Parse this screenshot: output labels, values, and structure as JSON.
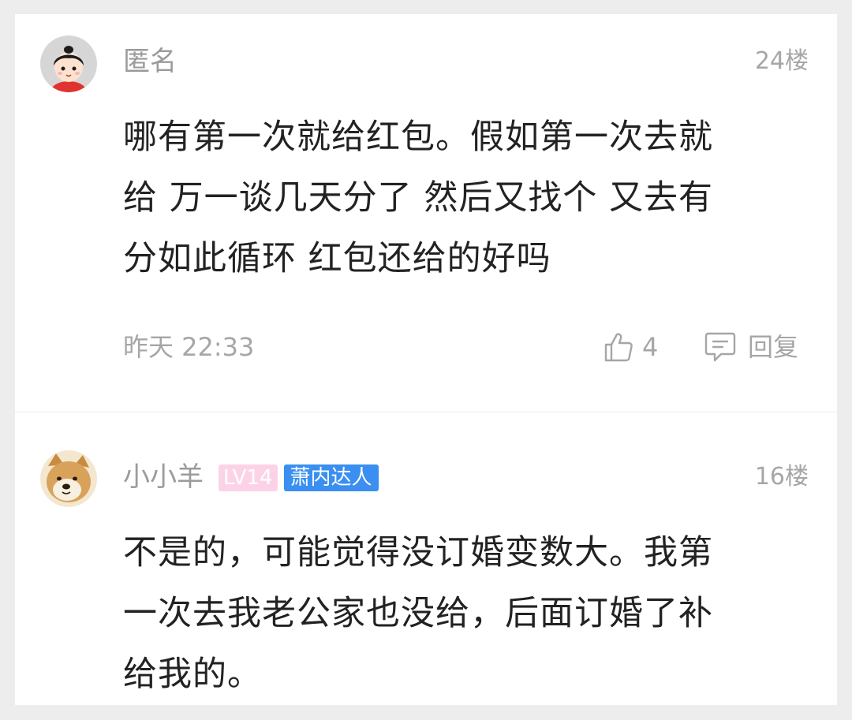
{
  "comments": [
    {
      "username": "匿名",
      "floor": "24楼",
      "text": "哪有第一次就给红包。假如第一次去就\n给 万一谈几天分了 然后又找个 又去有\n分如此循环 红包还给的好吗",
      "time": "昨天 22:33",
      "likes": "4",
      "reply_label": "回复"
    },
    {
      "username": "小小羊",
      "level_badge": "LV14",
      "title_badge": "萧内达人",
      "floor": "16楼",
      "text": "不是的，可能觉得没订婚变数大。我第\n一次去我老公家也没给，后面订婚了补\n给我的。"
    }
  ],
  "colors": {
    "level_badge_bg": "#fcd3e6",
    "title_badge_bg": "#3a8ff0",
    "muted_text": "#a6a6a6",
    "body_text": "#222222"
  },
  "icons": {
    "like": "thumbs-up-icon",
    "reply": "comment-bubble-icon"
  }
}
